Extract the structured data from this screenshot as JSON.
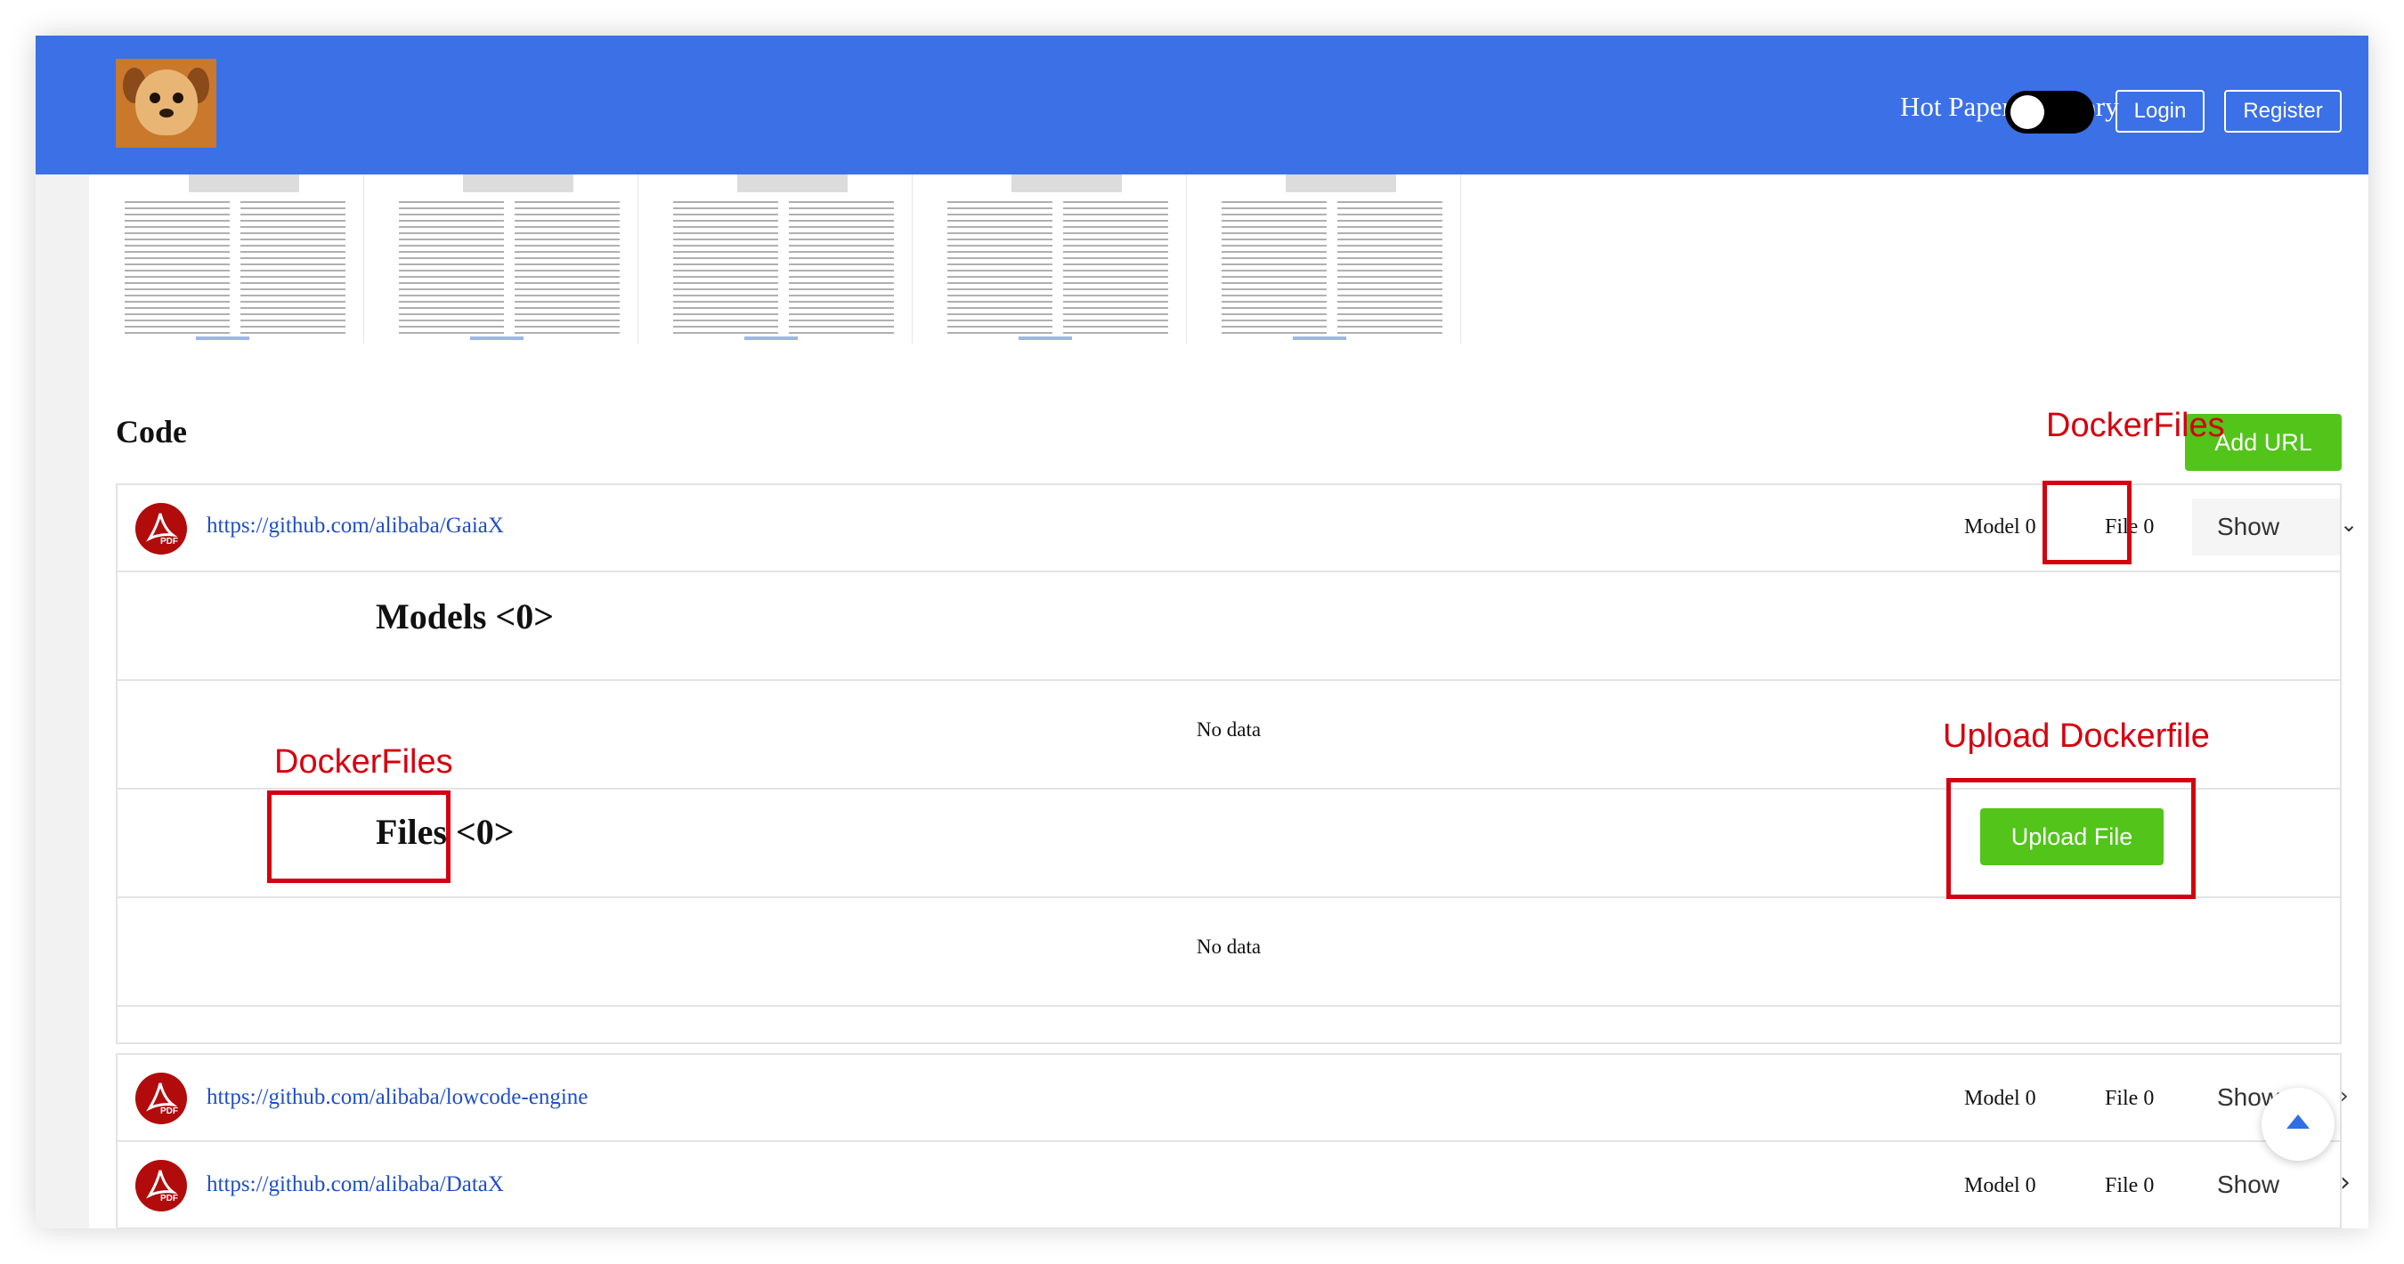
{
  "header": {
    "nav": [
      "Hot Papers",
      "Category"
    ],
    "login_label": "Login",
    "register_label": "Register",
    "background_color": "#3b70e6"
  },
  "code_section": {
    "title": "Code",
    "add_url_label": "Add URL"
  },
  "annotations": {
    "top_label": "DockerFiles",
    "left_label": "DockerFiles",
    "upload_label": "Upload Dockerfile",
    "color": "#d4000f"
  },
  "repos": [
    {
      "url": "https://github.com/alibaba/GaiaX",
      "model": "Model 0",
      "file": "File 0",
      "show": "Show",
      "expanded": true
    },
    {
      "url": "https://github.com/alibaba/lowcode-engine",
      "model": "Model 0",
      "file": "File 0",
      "show": "Show",
      "expanded": false
    },
    {
      "url": "https://github.com/alibaba/DataX",
      "model": "Model 0",
      "file": "File 0",
      "show": "Show",
      "expanded": false
    }
  ],
  "expanded": {
    "models_title": "Models <0>",
    "files_title": "Files <0>",
    "no_data": "No data",
    "upload_label": "Upload File"
  },
  "icons": [
    "pdf-icon",
    "chevron-down-icon",
    "chevron-right-icon",
    "back-to-top-icon"
  ],
  "accent_green": "#52c41a"
}
